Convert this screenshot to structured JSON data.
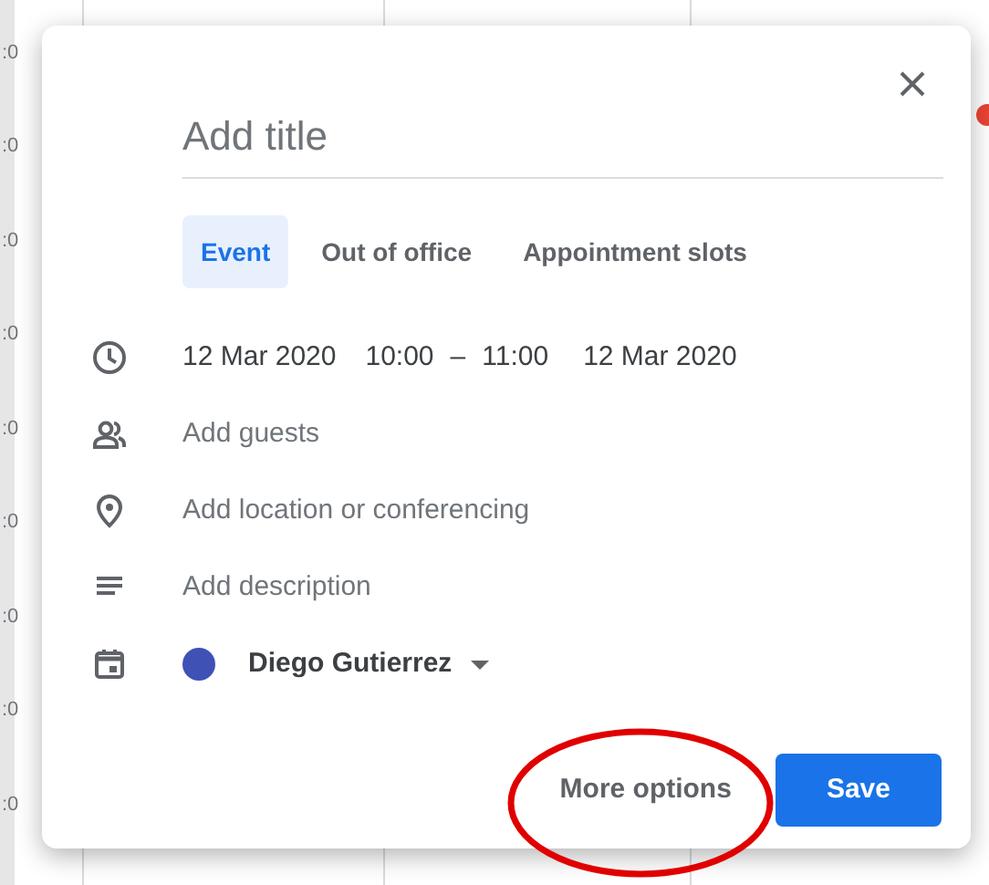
{
  "calendar": {
    "hour_labels": [
      ":0",
      ":0",
      ":0",
      ":0",
      ":0",
      ":0",
      ":0",
      ":0",
      ":0"
    ]
  },
  "dialog": {
    "title_field": {
      "placeholder": "Add title"
    },
    "tabs": [
      {
        "label": "Event",
        "selected": true
      },
      {
        "label": "Out of office",
        "selected": false
      },
      {
        "label": "Appointment slots",
        "selected": false
      }
    ],
    "rows": [
      {
        "kind": "datetime",
        "start_date": "12 Mar 2020",
        "start_time": "10:00",
        "separator": "–",
        "end_time": "11:00",
        "end_date": "12 Mar 2020"
      },
      {
        "kind": "guests",
        "placeholder": "Add guests"
      },
      {
        "kind": "location",
        "placeholder": "Add location or conferencing"
      },
      {
        "kind": "description",
        "placeholder": "Add description"
      },
      {
        "kind": "calendar",
        "name": "Diego Gutierrez",
        "color": "#3f51b5"
      }
    ],
    "buttons": [
      {
        "kind": "text",
        "label": "More options"
      },
      {
        "kind": "primary",
        "label": "Save"
      }
    ]
  }
}
